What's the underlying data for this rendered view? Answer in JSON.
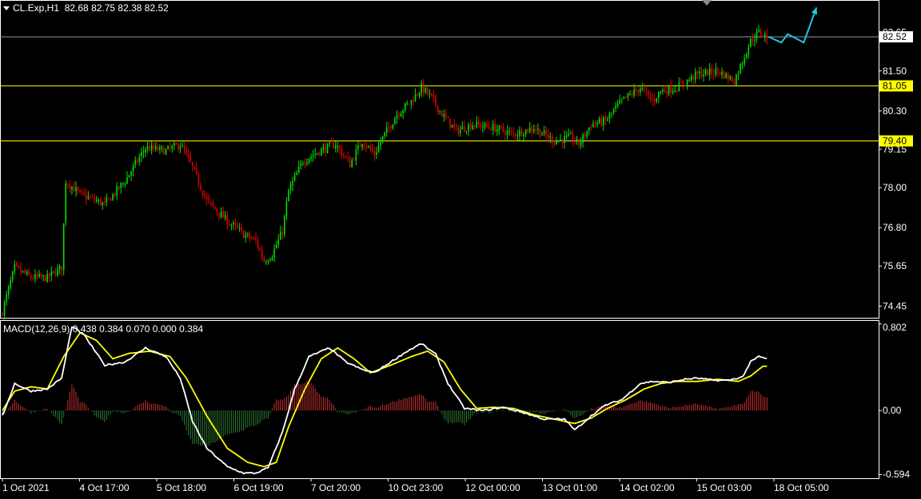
{
  "header": {
    "symbol": "CL.Exp,H1",
    "ohlc": "82.68 82.75 82.38 82.52"
  },
  "macd": {
    "label": "MACD(12,26,9)",
    "values": "0.438 0.384 0.070 0.000 0.384"
  },
  "colors": {
    "background": "#000000",
    "bull": "#00e000",
    "bear": "#e00000",
    "level_line": "#ffff00",
    "price_line": "#8c9ab0",
    "macd_line": "#ffffff",
    "signal_line": "#ffff00",
    "forecast": "#1fc8e0"
  },
  "chart_data": [
    {
      "type": "candlestick",
      "title": "CL.Exp,H1",
      "x_tick_labels": [
        "1 Oct 2021",
        "4 Oct 17:00",
        "5 Oct 18:00",
        "6 Oct 19:00",
        "7 Oct 20:00",
        "10 Oct 23:00",
        "12 Oct 00:00",
        "13 Oct 01:00",
        "14 Oct 02:00",
        "15 Oct 03:00",
        "18 Oct 05:00"
      ],
      "y_tick_labels": [
        "82.65",
        "81.50",
        "80.30",
        "79.15",
        "78.00",
        "76.80",
        "75.65",
        "74.45"
      ],
      "ylim": [
        74.1,
        83.6
      ],
      "horizontal_levels": [
        {
          "value": 81.05,
          "label": "81.05"
        },
        {
          "value": 79.4,
          "label": "79.40"
        }
      ],
      "current_price": {
        "value": 82.52,
        "label": "82.52"
      },
      "close_path_anchors": [
        [
          0,
          74.3
        ],
        [
          6,
          75.6
        ],
        [
          14,
          75.3
        ],
        [
          22,
          75.3
        ],
        [
          29,
          75.6
        ],
        [
          31,
          78.2
        ],
        [
          38,
          77.8
        ],
        [
          50,
          77.5
        ],
        [
          60,
          78.2
        ],
        [
          70,
          79.2
        ],
        [
          80,
          79.1
        ],
        [
          87,
          79.3
        ],
        [
          93,
          78.6
        ],
        [
          100,
          77.6
        ],
        [
          110,
          77.0
        ],
        [
          118,
          76.6
        ],
        [
          124,
          76.4
        ],
        [
          128,
          75.8
        ],
        [
          132,
          76.0
        ],
        [
          137,
          76.7
        ],
        [
          140,
          77.9
        ],
        [
          147,
          78.8
        ],
        [
          155,
          79.1
        ],
        [
          163,
          79.3
        ],
        [
          170,
          78.7
        ],
        [
          176,
          79.4
        ],
        [
          182,
          79.0
        ],
        [
          186,
          79.5
        ],
        [
          193,
          80.2
        ],
        [
          200,
          80.6
        ],
        [
          205,
          81.0
        ],
        [
          210,
          80.7
        ],
        [
          215,
          80.2
        ],
        [
          222,
          79.7
        ],
        [
          230,
          79.9
        ],
        [
          240,
          79.8
        ],
        [
          250,
          79.6
        ],
        [
          260,
          79.8
        ],
        [
          270,
          79.4
        ],
        [
          278,
          79.5
        ],
        [
          282,
          79.3
        ],
        [
          288,
          79.9
        ],
        [
          295,
          80.0
        ],
        [
          303,
          80.6
        ],
        [
          312,
          81.0
        ],
        [
          318,
          80.6
        ],
        [
          322,
          80.9
        ],
        [
          330,
          81.0
        ],
        [
          340,
          81.4
        ],
        [
          350,
          81.5
        ],
        [
          358,
          81.2
        ],
        [
          362,
          81.8
        ],
        [
          366,
          82.4
        ],
        [
          370,
          82.65
        ],
        [
          374,
          82.52
        ]
      ],
      "forecast_arrow": [
        [
          0,
          82.52
        ],
        [
          8,
          82.35
        ],
        [
          12,
          82.6
        ],
        [
          22,
          82.35
        ],
        [
          30,
          83.4
        ]
      ],
      "macd": {
        "title": "MACD(12,26,9)",
        "y_tick_labels": [
          "0.802",
          "0.00",
          "-0.594"
        ],
        "ylim": [
          -0.62,
          0.83
        ],
        "macd_anchors": [
          [
            0,
            -0.05
          ],
          [
            6,
            0.25
          ],
          [
            14,
            0.18
          ],
          [
            22,
            0.2
          ],
          [
            29,
            0.3
          ],
          [
            34,
            0.78
          ],
          [
            40,
            0.7
          ],
          [
            50,
            0.42
          ],
          [
            60,
            0.45
          ],
          [
            70,
            0.58
          ],
          [
            80,
            0.5
          ],
          [
            87,
            0.3
          ],
          [
            93,
            -0.1
          ],
          [
            100,
            -0.35
          ],
          [
            110,
            -0.52
          ],
          [
            118,
            -0.58
          ],
          [
            124,
            -0.58
          ],
          [
            130,
            -0.53
          ],
          [
            137,
            -0.2
          ],
          [
            143,
            0.2
          ],
          [
            150,
            0.5
          ],
          [
            160,
            0.58
          ],
          [
            168,
            0.45
          ],
          [
            176,
            0.38
          ],
          [
            182,
            0.35
          ],
          [
            190,
            0.45
          ],
          [
            198,
            0.55
          ],
          [
            205,
            0.62
          ],
          [
            212,
            0.52
          ],
          [
            218,
            0.25
          ],
          [
            226,
            0.02
          ],
          [
            235,
            0.0
          ],
          [
            245,
            0.03
          ],
          [
            255,
            -0.02
          ],
          [
            265,
            -0.08
          ],
          [
            275,
            -0.08
          ],
          [
            280,
            -0.18
          ],
          [
            288,
            -0.05
          ],
          [
            295,
            0.05
          ],
          [
            303,
            0.1
          ],
          [
            312,
            0.25
          ],
          [
            318,
            0.27
          ],
          [
            326,
            0.26
          ],
          [
            334,
            0.29
          ],
          [
            340,
            0.3
          ],
          [
            348,
            0.28
          ],
          [
            355,
            0.28
          ],
          [
            362,
            0.31
          ],
          [
            366,
            0.45
          ],
          [
            370,
            0.5
          ],
          [
            374,
            0.48
          ]
        ],
        "signal_anchors": [
          [
            0,
            0.0
          ],
          [
            6,
            0.18
          ],
          [
            14,
            0.22
          ],
          [
            22,
            0.2
          ],
          [
            30,
            0.5
          ],
          [
            38,
            0.72
          ],
          [
            46,
            0.65
          ],
          [
            54,
            0.48
          ],
          [
            62,
            0.53
          ],
          [
            72,
            0.55
          ],
          [
            82,
            0.5
          ],
          [
            90,
            0.3
          ],
          [
            100,
            -0.05
          ],
          [
            110,
            -0.35
          ],
          [
            120,
            -0.48
          ],
          [
            128,
            -0.52
          ],
          [
            134,
            -0.48
          ],
          [
            140,
            -0.15
          ],
          [
            148,
            0.2
          ],
          [
            156,
            0.48
          ],
          [
            164,
            0.58
          ],
          [
            172,
            0.48
          ],
          [
            180,
            0.35
          ],
          [
            190,
            0.42
          ],
          [
            200,
            0.5
          ],
          [
            208,
            0.55
          ],
          [
            216,
            0.45
          ],
          [
            224,
            0.2
          ],
          [
            232,
            0.02
          ],
          [
            240,
            0.03
          ],
          [
            250,
            0.02
          ],
          [
            260,
            -0.04
          ],
          [
            270,
            -0.08
          ],
          [
            280,
            -0.12
          ],
          [
            288,
            -0.07
          ],
          [
            296,
            0.02
          ],
          [
            305,
            0.1
          ],
          [
            314,
            0.2
          ],
          [
            322,
            0.25
          ],
          [
            330,
            0.27
          ],
          [
            340,
            0.27
          ],
          [
            350,
            0.29
          ],
          [
            360,
            0.27
          ],
          [
            366,
            0.32
          ],
          [
            372,
            0.41
          ]
        ]
      }
    }
  ]
}
